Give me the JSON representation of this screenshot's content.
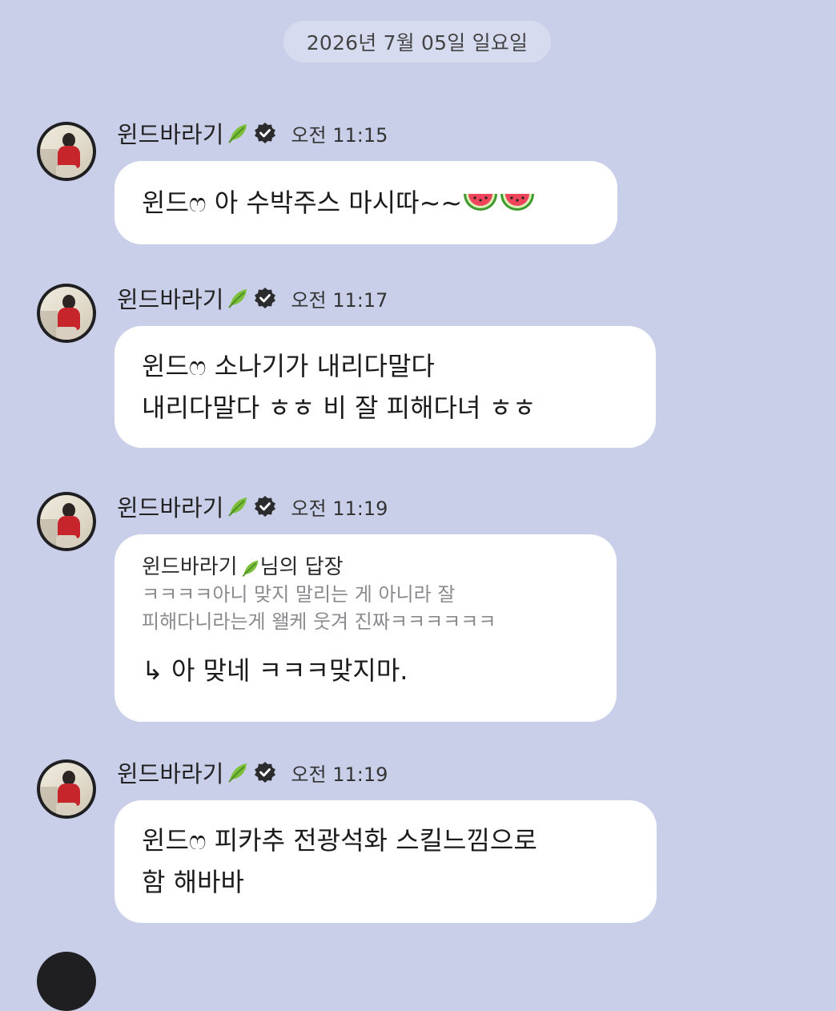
{
  "chat": {
    "date": "2026년 7월 05일 일요일"
  },
  "messages": [
    {
      "sender": "윈드바라기",
      "time": "오전 11:15",
      "lines": [
        "윈드ෆ 아 수박주스 마시따~~"
      ],
      "emoji_trailing": "watermelon-icon x2"
    },
    {
      "sender": "윈드바라기",
      "time": "오전 11:17",
      "lines": [
        "윈드ෆ 소나기가 내리다말다",
        "내리다말다 ㅎㅎ 비 잘 피해다녀 ㅎㅎ"
      ]
    },
    {
      "sender": "윈드바라기",
      "time": "오전 11:19",
      "reply_header_pre": "윈드바라기",
      "reply_header_post": "님의 답장",
      "reply_quote": [
        "ㅋㅋㅋㅋ아니 맞지 말리는 게 아니라 잘",
        "피해다니라는게 왤케 웃겨 진짜ㅋㅋㅋㅋㅋㅋ"
      ],
      "reply_text": "↳ 아 맞네 ㅋㅋㅋ맞지마."
    },
    {
      "sender": "윈드바라기",
      "time": "오전 11:19",
      "lines": [
        "윈드ෆ 피카추 전광석화 스킬느낌으로",
        "함 해바바"
      ]
    }
  ],
  "colors": {
    "background": "#c9cfe9",
    "bubble": "#ffffff",
    "date_pill": "#d6dbef",
    "leaf": "#7bbf3a",
    "badge": "#2c2c2e"
  }
}
